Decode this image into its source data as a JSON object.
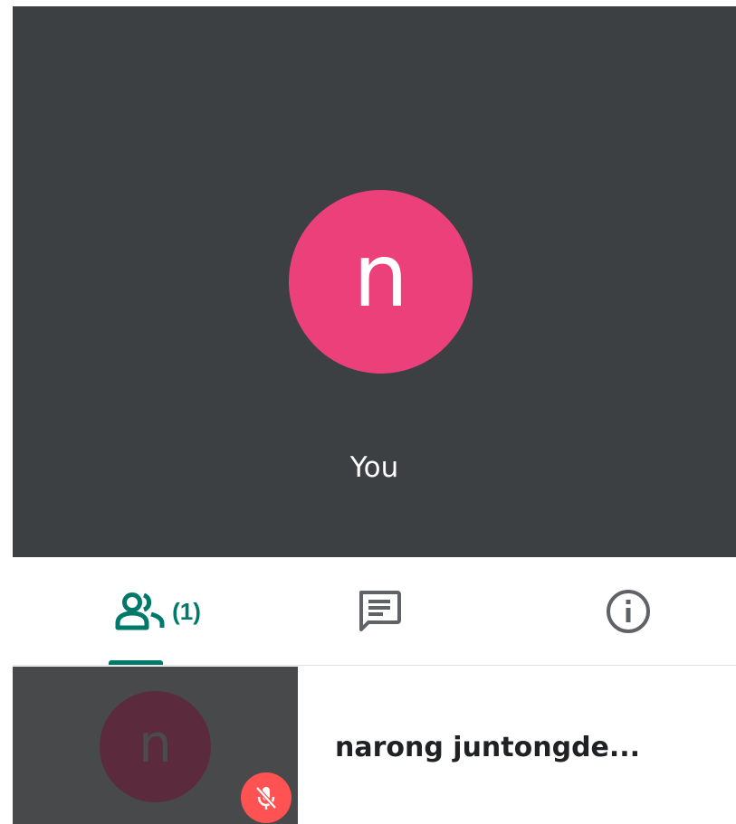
{
  "main_tile": {
    "avatar_initial": "n",
    "name_label": "You",
    "avatar_color": "#ec407a",
    "background_color": "#3c4043"
  },
  "tabs": {
    "people": {
      "icon": "people-icon",
      "count": "(1)",
      "selected": true
    },
    "chat": {
      "icon": "chat-icon",
      "selected": false
    },
    "info": {
      "icon": "info-icon",
      "selected": false
    },
    "accent_color": "#00796b"
  },
  "participants": [
    {
      "avatar_initial": "n",
      "name": "narong juntongde...",
      "muted": true,
      "mute_icon": "mic-off-icon",
      "mute_color": "#ff5252"
    }
  ]
}
